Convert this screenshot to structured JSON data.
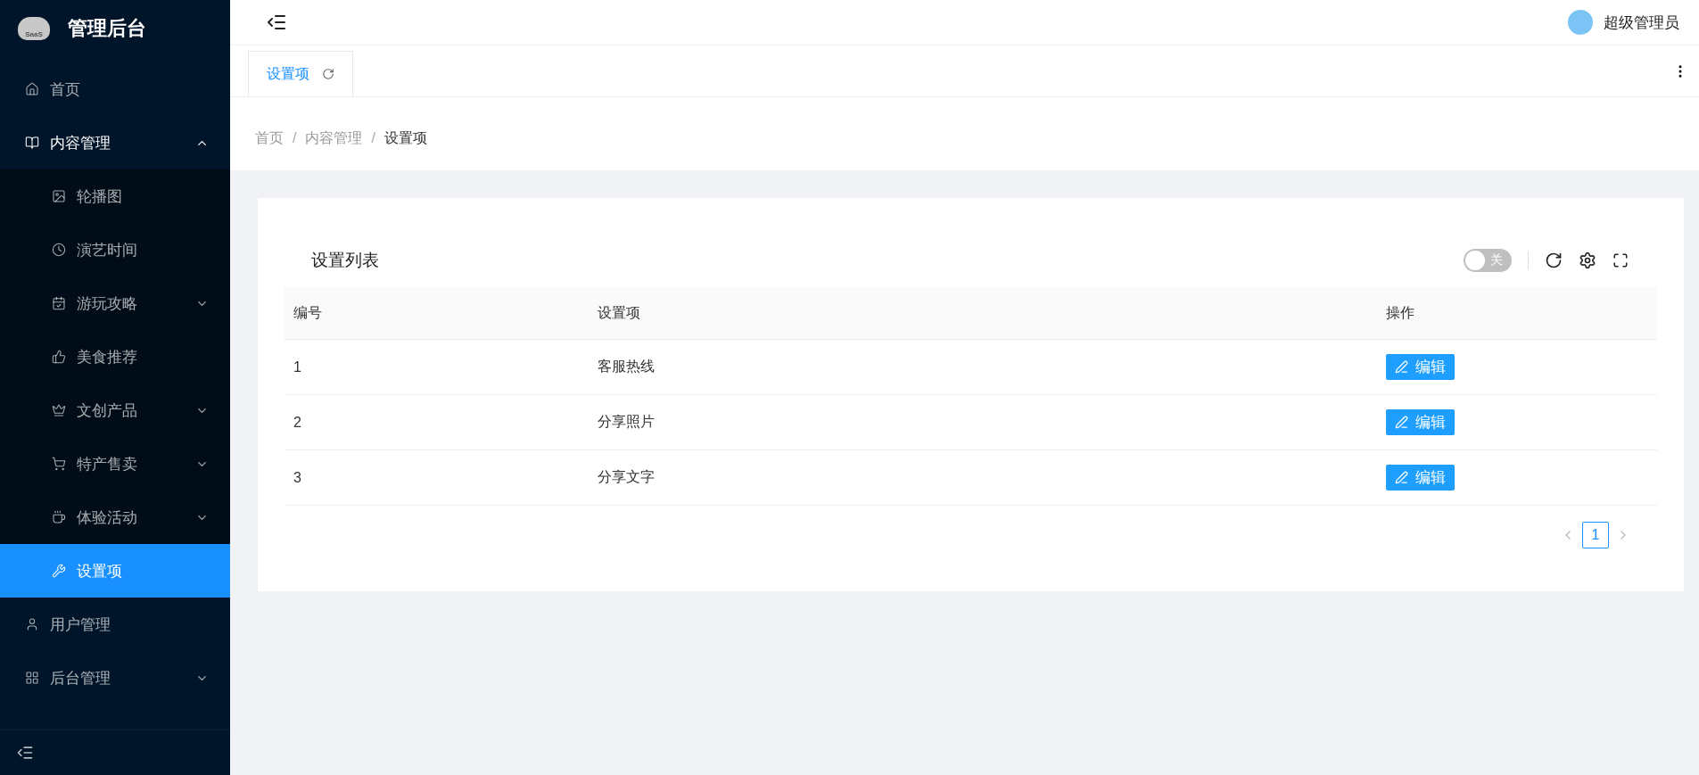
{
  "sidebar": {
    "logo_badge": "SaaS",
    "title": "管理后台",
    "items": [
      {
        "label": "首页",
        "selected": false
      },
      {
        "label": "内容管理",
        "selected": false,
        "expanded": true,
        "children": [
          {
            "label": "轮播图",
            "selected": false
          },
          {
            "label": "演艺时间",
            "selected": false
          },
          {
            "label": "游玩攻略",
            "selected": false,
            "expanded": false
          },
          {
            "label": "美食推荐",
            "selected": false
          },
          {
            "label": "文创产品",
            "selected": false,
            "expanded": false
          },
          {
            "label": "特产售卖",
            "selected": false,
            "expanded": false
          },
          {
            "label": "体验活动",
            "selected": false,
            "expanded": false
          },
          {
            "label": "设置项",
            "selected": true
          }
        ]
      },
      {
        "label": "用户管理",
        "selected": false
      },
      {
        "label": "后台管理",
        "selected": false,
        "expanded": false
      }
    ]
  },
  "header": {
    "user": "超级管理员"
  },
  "tabs": [
    {
      "label": "设置项",
      "selected": true
    }
  ],
  "breadcrumb": {
    "separator": "/",
    "items": [
      "首页",
      "内容管理",
      "设置项"
    ]
  },
  "card": {
    "title": "设置列表",
    "toggle": {
      "label": "关",
      "on": false
    },
    "table": {
      "columns": [
        "编号",
        "设置项",
        "操作"
      ],
      "rows": [
        {
          "id": "1",
          "name": "客服热线",
          "action": "编辑"
        },
        {
          "id": "2",
          "name": "分享照片",
          "action": "编辑"
        },
        {
          "id": "3",
          "name": "分享文字",
          "action": "编辑"
        }
      ]
    },
    "pagination": {
      "pages": [
        {
          "label": "1",
          "selected": true
        }
      ]
    }
  }
}
